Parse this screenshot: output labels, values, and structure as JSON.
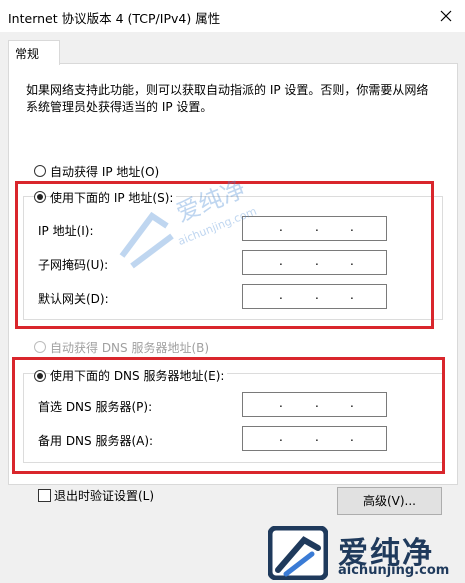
{
  "window": {
    "title": "Internet 协议版本 4 (TCP/IPv4) 属性",
    "close_icon": "close-icon"
  },
  "tabs": [
    {
      "label": "常规",
      "selected": true
    }
  ],
  "description": "如果网络支持此功能，则可以获取自动指派的 IP 设置。否则，你需要从网络系统管理员处获得适当的 IP 设置。",
  "ip_section": {
    "auto_label": "自动获得 IP 地址(O)",
    "manual_label": "使用下面的 IP 地址(S):",
    "selected": "manual",
    "fields": [
      {
        "label": "IP 地址(I):",
        "value": ". . ."
      },
      {
        "label": "子网掩码(U):",
        "value": ". . ."
      },
      {
        "label": "默认网关(D):",
        "value": ". . ."
      }
    ]
  },
  "dns_section": {
    "auto_label": "自动获得 DNS 服务器地址(B)",
    "auto_disabled": true,
    "manual_label": "使用下面的 DNS 服务器地址(E):",
    "selected": "manual",
    "fields": [
      {
        "label": "首选 DNS 服务器(P):",
        "value": ". . ."
      },
      {
        "label": "备用 DNS 服务器(A):",
        "value": ". . ."
      }
    ]
  },
  "validate_checkbox": {
    "label": "退出时验证设置(L)",
    "checked": false
  },
  "advanced_button": {
    "label": "高级(V)..."
  },
  "watermark": {
    "brand": "爱纯净",
    "url": "aichunjing.com",
    "center_url": "aichunjing.com",
    "colors": {
      "dark": "#1f3a5c",
      "light": "#4a8bd6"
    }
  },
  "colors": {
    "highlight_red": "#d9262c",
    "panel": "#ffffff",
    "background": "#f0f0f0"
  }
}
